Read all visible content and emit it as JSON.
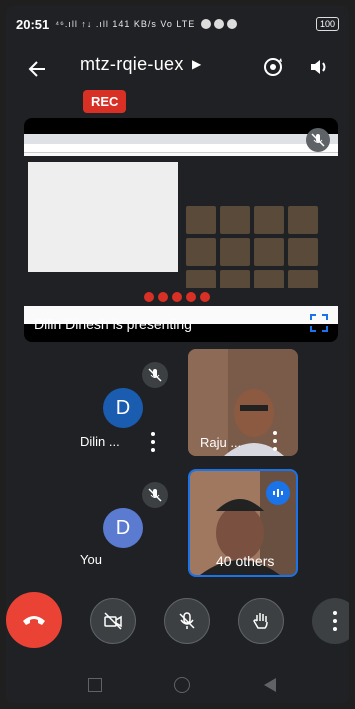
{
  "status": {
    "time": "20:51",
    "signal": "⁴⁶.ıll ↑↓ .ıll 141 KB/s Vo LTE",
    "battery": "100"
  },
  "meeting": {
    "code": "mtz-rqie-uex",
    "rec_label": "REC"
  },
  "presentation": {
    "caption": "Dilin Dinesh is presenting"
  },
  "participants": [
    {
      "name": "Dilin ...",
      "initial": "D",
      "avatar_color": "#1a5cb0"
    },
    {
      "name": "Raju ..."
    },
    {
      "name": "You",
      "initial": "D",
      "avatar_color": "#5a7bd0"
    },
    {
      "name": "40 others"
    }
  ],
  "colors": {
    "background": "#202124",
    "rec": "#d93025",
    "end_call": "#ea4335",
    "active_border": "#1a73e8"
  }
}
